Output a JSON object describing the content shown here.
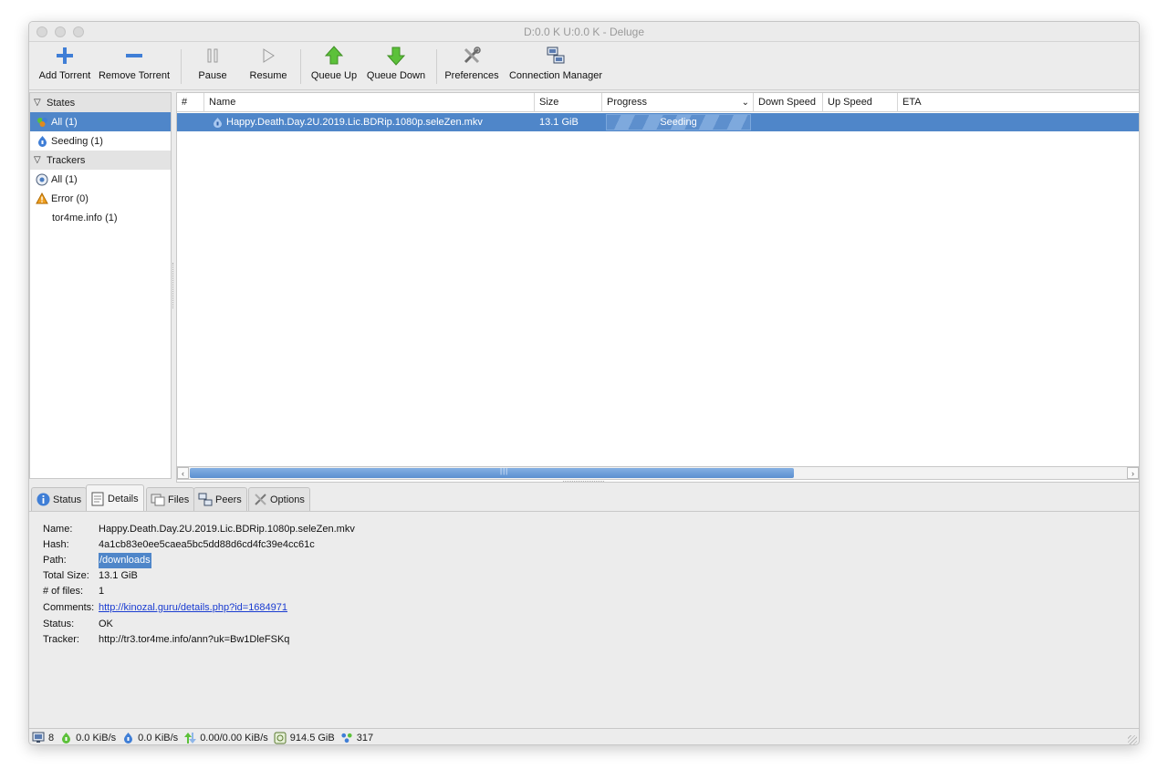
{
  "window": {
    "title": "D:0.0 K U:0.0 K - Deluge"
  },
  "toolbar": {
    "add_torrent": "Add Torrent",
    "remove_torrent": "Remove Torrent",
    "pause": "Pause",
    "resume": "Resume",
    "queue_up": "Queue Up",
    "queue_down": "Queue Down",
    "preferences": "Preferences",
    "connection_manager": "Connection Manager"
  },
  "sidebar": {
    "states_header": "States",
    "states": [
      {
        "label": "All (1)",
        "icon": "all-states-icon"
      },
      {
        "label": "Seeding (1)",
        "icon": "seeding-icon"
      }
    ],
    "trackers_header": "Trackers",
    "trackers": [
      {
        "label": "All (1)",
        "icon": "globe-icon"
      },
      {
        "label": "Error (0)",
        "icon": "warning-icon"
      },
      {
        "label": "tor4me.info (1)",
        "icon": ""
      }
    ]
  },
  "torrent_list": {
    "columns": [
      "#",
      "Name",
      "Size",
      "Progress",
      "Down Speed",
      "Up Speed",
      "ETA"
    ],
    "rows": [
      {
        "queue": "",
        "name": "Happy.Death.Day.2U.2019.Lic.BDRip.1080p.seleZen.mkv",
        "size": "13.1 GiB",
        "progress_label": "Seeding",
        "progress_fraction": 1.0,
        "down_speed": "",
        "up_speed": "",
        "eta": ""
      }
    ]
  },
  "tabs": [
    "Status",
    "Details",
    "Files",
    "Peers",
    "Options"
  ],
  "details": {
    "name_key": "Name:",
    "name": "Happy.Death.Day.2U.2019.Lic.BDRip.1080p.seleZen.mkv",
    "hash_key": "Hash:",
    "hash": "4a1cb83e0ee5caea5bc5dd88d6cd4fc39e4cc61c",
    "path_key": "Path:",
    "path": "/downloads",
    "total_size_key": "Total Size:",
    "total_size": "13.1 GiB",
    "files_key": "# of files:",
    "files": "1",
    "comments_key": "Comments:",
    "comments": "http://kinozal.guru/details.php?id=1684971",
    "status_key": "Status:",
    "status": "OK",
    "tracker_key": "Tracker:",
    "tracker": "http://tr3.tor4me.info/ann?uk=Bw1DleFSKq"
  },
  "statusbar": {
    "connections": "8",
    "download_speed": "0.0 KiB/s",
    "upload_speed": "0.0 KiB/s",
    "protocol_traffic": "0.00/0.00 KiB/s",
    "free_space": "914.5 GiB",
    "dht_nodes": "317"
  }
}
